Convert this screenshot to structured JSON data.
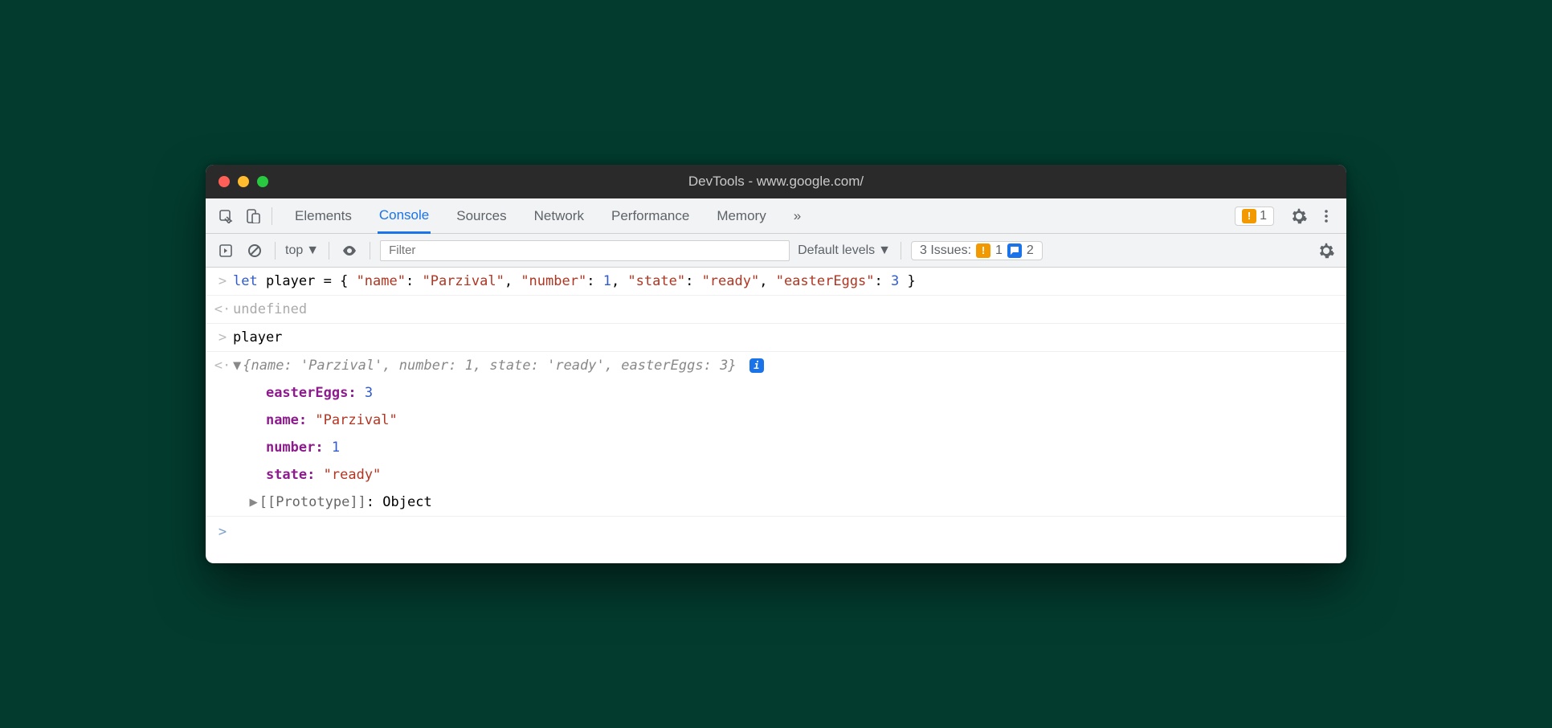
{
  "window": {
    "title": "DevTools - www.google.com/"
  },
  "tabs": {
    "items": [
      "Elements",
      "Console",
      "Sources",
      "Network",
      "Performance",
      "Memory"
    ],
    "active": "Console",
    "warning_count": "1"
  },
  "console_toolbar": {
    "context": "top",
    "filter_placeholder": "Filter",
    "levels": "Default levels",
    "issues_label": "3 Issues:",
    "issues_warn": "1",
    "issues_msg": "2"
  },
  "console": {
    "input1_prefix": "let ",
    "input1_var": "player",
    "input1_eq": " = { ",
    "input1_k1": "\"name\"",
    "input1_v1": "\"Parzival\"",
    "input1_k2": "\"number\"",
    "input1_v2": "1",
    "input1_k3": "\"state\"",
    "input1_v3": "\"ready\"",
    "input1_k4": "\"easterEggs\"",
    "input1_v4": "3",
    "input1_close": " }",
    "out1": "undefined",
    "input2": "player",
    "summary_open": "{",
    "summary_name_k": "name:",
    "summary_name_v": "'Parzival'",
    "summary_number_k": "number:",
    "summary_number_v": "1",
    "summary_state_k": "state:",
    "summary_state_v": "'ready'",
    "summary_eggs_k": "easterEggs:",
    "summary_eggs_v": "3",
    "summary_close": "}",
    "prop1_k": "easterEggs",
    "prop1_v": "3",
    "prop2_k": "name",
    "prop2_v": "\"Parzival\"",
    "prop3_k": "number",
    "prop3_v": "1",
    "prop4_k": "state",
    "prop4_v": "\"ready\"",
    "proto_label": "[[Prototype]]",
    "proto_v": "Object"
  }
}
